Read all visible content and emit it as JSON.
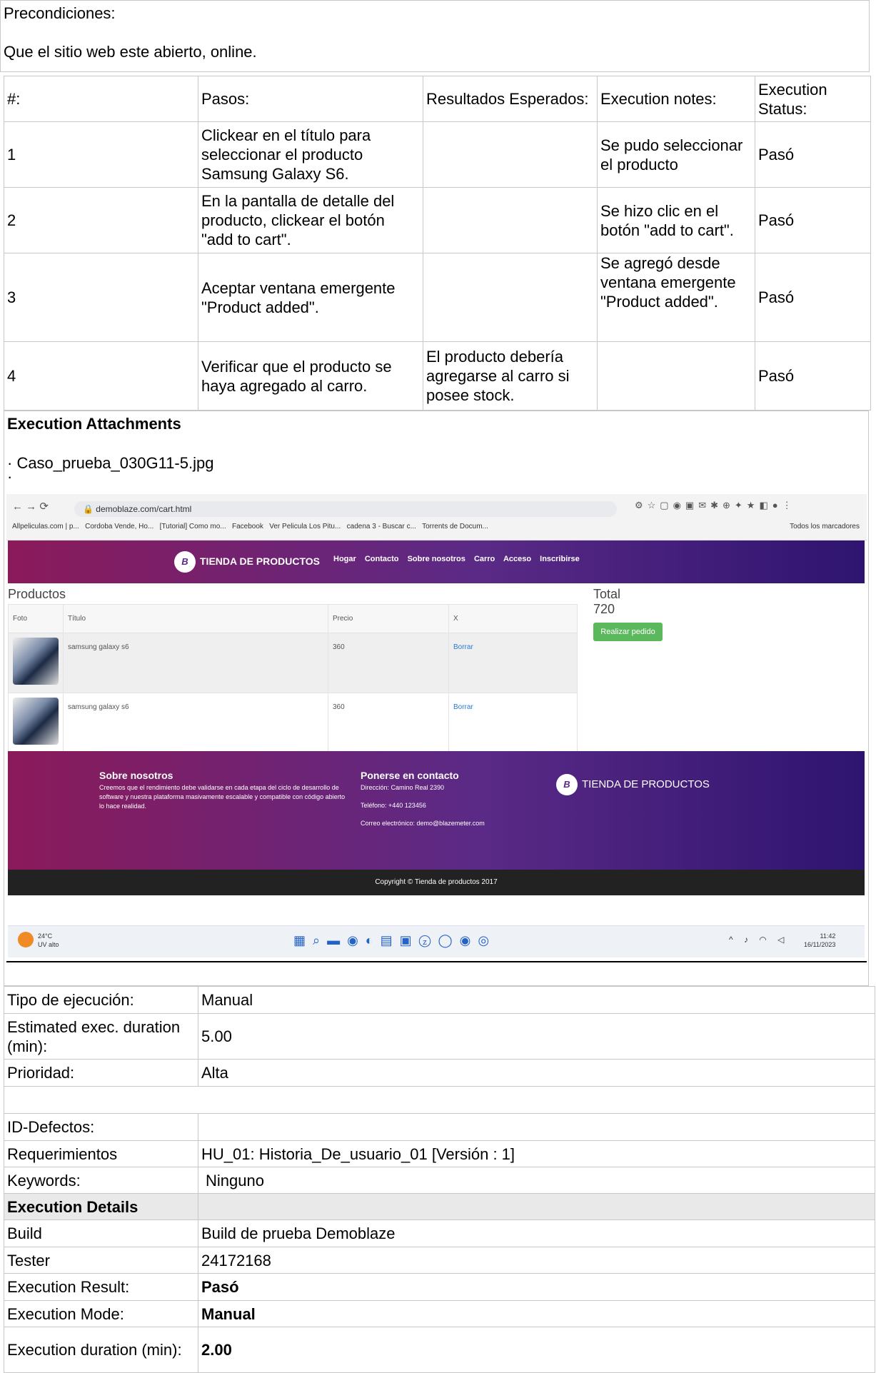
{
  "preconditions": {
    "label": "Precondiciones:",
    "text": "Que el sitio web este abierto, online."
  },
  "steps": {
    "headers": [
      "#:",
      "Pasos:",
      "Resultados Esperados:",
      "Execution notes:",
      "Execution Status:"
    ],
    "rows": [
      {
        "num": "1",
        "step": "Clickear en el título para seleccionar el producto Samsung Galaxy S6.",
        "expected": "",
        "notes": "Se pudo seleccionar el producto",
        "status": "Pasó"
      },
      {
        "num": "2",
        "step": "En la pantalla de detalle del producto, clickear el botón \"add to cart\".",
        "expected": "",
        "notes": "Se hizo clic en el botón \"add to cart\".",
        "status": "Pasó"
      },
      {
        "num": "3",
        "step": "Aceptar ventana emergente \"Product added\".",
        "expected": "",
        "notes": "Se agregó desde ventana emergente \"Product added\".",
        "status": "Pasó"
      },
      {
        "num": "4",
        "step": "Verificar que el producto se haya agregado al carro.",
        "expected": "El producto debería agregarse al carro si posee stock.",
        "notes": "",
        "status": "Pasó"
      }
    ]
  },
  "attachments": {
    "title": "Execution Attachments",
    "file": "· Caso_prueba_030G11-5.jpg",
    "dot": "·"
  },
  "screenshot": {
    "url": "demoblaze.com/cart.html",
    "bookmarks": [
      "Allpeliculas.com | p...",
      "Cordoba Vende, Ho...",
      "[Tutorial] Como mo...",
      "Facebook",
      "Ver Pelicula Los Pitu...",
      "cadena 3 - Buscar c...",
      "Torrents de Docum...",
      "Todos los marcadores"
    ],
    "brand": "TIENDA DE PRODUCTOS",
    "logo": "B",
    "menu": [
      "Hogar",
      "Contacto",
      "Sobre nosotros",
      "Carro",
      "Acceso",
      "Inscribirse"
    ],
    "products_title": "Productos",
    "cart_headers": [
      "Foto",
      "Título",
      "Precio",
      "X"
    ],
    "cart_rows": [
      {
        "title": "samsung galaxy s6",
        "price": "360",
        "action": "Borrar"
      },
      {
        "title": "samsung galaxy s6",
        "price": "360",
        "action": "Borrar"
      }
    ],
    "total_label": "Total",
    "total_value": "720",
    "order_button": "Realizar pedido",
    "footer_about_title": "Sobre nosotros",
    "footer_about_text": "Creemos que el rendimiento debe validarse en cada etapa del ciclo de desarrollo de software y nuestra plataforma masivamente escalable y compatible con código abierto lo hace realidad.",
    "footer_contact_title": "Ponerse en contacto",
    "footer_contact_address": "Dirección: Camino Real 2390",
    "footer_contact_phone": "Teléfono: +440 123456",
    "footer_contact_email": "Correo electrónico: demo@blazemeter.com",
    "copyright": "Copyright © Tienda de productos 2017",
    "weather_temp": "24°C",
    "weather_desc": "UV alto",
    "clock_time": "11:42",
    "clock_date": "16/11/2023"
  },
  "info": {
    "exec_type_label": "Tipo de ejecución:",
    "exec_type": "Manual",
    "est_label": "Estimated exec. duration (min):",
    "est": "5.00",
    "priority_label": "Prioridad:",
    "priority": "Alta",
    "defects_label": "ID-Defectos:",
    "defects": "",
    "req_label": "Requerimientos",
    "req": "HU_01: Historia_De_usuario_01 [Versión : 1]",
    "keywords_label": "Keywords:",
    "keywords": "Ninguno",
    "details_label": "Execution Details",
    "build_label": "Build",
    "build": "Build de prueba Demoblaze",
    "tester_label": "Tester",
    "tester": "24172168",
    "result_label": "Execution Result:",
    "result": "Pasó",
    "mode_label": "Execution Mode:",
    "mode": "Manual",
    "duration_label": "Execution duration (min):",
    "duration": "2.00"
  }
}
